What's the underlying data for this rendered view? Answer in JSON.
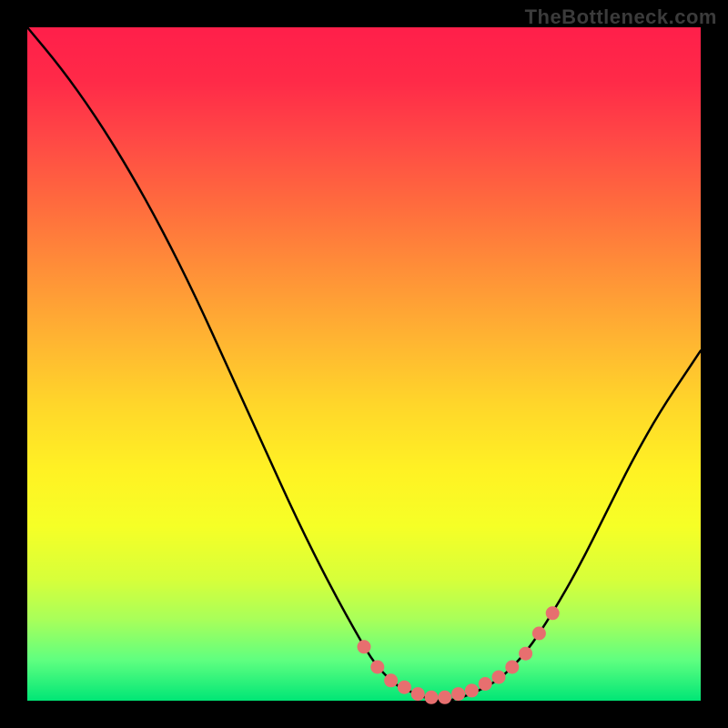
{
  "watermark": "TheBottleneck.com",
  "colors": {
    "background": "#000000",
    "curve_stroke": "#000000",
    "marker_fill": "#e76f6f",
    "marker_stroke": "#c74b4b",
    "gradient_top": "#ff1f4a",
    "gradient_bottom": "#00e676"
  },
  "chart_data": {
    "type": "line",
    "title": "",
    "xlabel": "",
    "ylabel": "",
    "xlim": [
      0,
      100
    ],
    "ylim": [
      0,
      100
    ],
    "grid": false,
    "legend": false,
    "curve": {
      "x": [
        0,
        5,
        10,
        15,
        20,
        25,
        30,
        35,
        40,
        45,
        50,
        52,
        55,
        58,
        60,
        63,
        66,
        70,
        74,
        78,
        82,
        86,
        90,
        94,
        98,
        100
      ],
      "y": [
        100,
        94,
        87,
        79,
        70,
        60,
        49,
        38,
        27,
        17,
        8,
        5,
        2,
        1,
        0,
        0,
        1,
        3,
        7,
        13,
        20,
        28,
        36,
        43,
        49,
        52
      ]
    },
    "markers": {
      "x": [
        50,
        52,
        54,
        56,
        58,
        60,
        62,
        64,
        66,
        68,
        70,
        72,
        74,
        76,
        78
      ],
      "y": [
        8,
        5,
        3,
        2,
        1,
        0.5,
        0.5,
        1,
        1.5,
        2.5,
        3.5,
        5,
        7,
        10,
        13
      ]
    }
  }
}
